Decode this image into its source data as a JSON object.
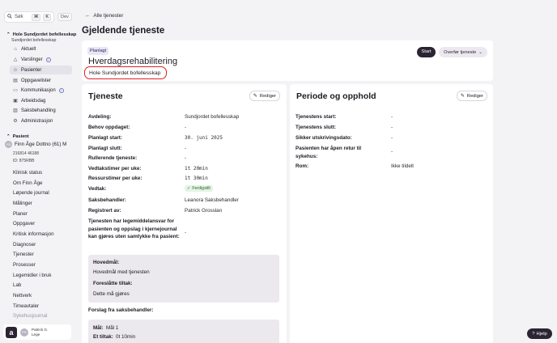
{
  "search": {
    "label": "Søk",
    "shortcut_cmd": "⌘",
    "shortcut_key": "K"
  },
  "dev_label": "Dev",
  "org": {
    "title": "Hole Sundjordet bofellesskap",
    "subtitle": "Sundjordet bofellesskap"
  },
  "nav": [
    {
      "label": "Aktuelt",
      "icon": "home-icon"
    },
    {
      "label": "Varslinger",
      "icon": "bell-icon",
      "badge": "i"
    },
    {
      "label": "Pasienter",
      "icon": "users-icon",
      "active": true
    },
    {
      "label": "Oppgavelister",
      "icon": "calendar-icon"
    },
    {
      "label": "Kommunikasjon",
      "icon": "chat-icon",
      "badge": "i"
    },
    {
      "label": "Arbeidsdag",
      "icon": "briefcase-icon"
    },
    {
      "label": "Saksbehandling",
      "icon": "folder-icon"
    },
    {
      "label": "Administrasjon",
      "icon": "gear-icon"
    }
  ],
  "patient": {
    "header": "Pasient",
    "initials": "FÅ",
    "name": "Finn Åge Dottno (61) M",
    "nr": "216814 46188",
    "id": "ID: 875RBB",
    "links": [
      "Klinisk status",
      "Om Finn Åge",
      "Løpende journal",
      "Målinger",
      "Planer",
      "Oppgaver",
      "Kritisk informasjon",
      "Diagnoser",
      "Tjenester",
      "Prosesser",
      "Legemidler i bruk",
      "Lab",
      "Nettverk",
      "Timeavtaler",
      "Sykehusjournal"
    ]
  },
  "user": {
    "initials": "PG",
    "name": "Patrick G.",
    "role": "Lege"
  },
  "back_label": "Alle tjenester",
  "page_title": "Gjeldende tjeneste",
  "service": {
    "status": "Planlagt",
    "name": "Hverdagsrehabilitering",
    "unit": "Hole Sundjordet bofellesskap",
    "start_label": "Start",
    "transfer_label": "Overfør tjeneste"
  },
  "tjeneste": {
    "title": "Tjeneste",
    "edit_label": "Rediger",
    "fields": [
      {
        "label": "Avdeling:",
        "value": "Sundjordet bofellesskap"
      },
      {
        "label": "Behov oppdaget:",
        "value": "-"
      },
      {
        "label": "Planlagt start:",
        "value": "30. juni 2025"
      },
      {
        "label": "Planlagt slutt:",
        "value": "-"
      },
      {
        "label": "Rullerende tjeneste:",
        "value": "-"
      },
      {
        "label": "Vedtakstimer per uke:",
        "value": "1t 20min"
      },
      {
        "label": "Ressurstimer per uke:",
        "value": "1t 30min"
      },
      {
        "label": "Vedtak:",
        "value": "Ferdigstilt"
      },
      {
        "label": "Saksbehandler:",
        "value": "Leanora Saksbehandler"
      },
      {
        "label": "Registrert av:",
        "value": "Patrick Grosslan"
      },
      {
        "label": "Tjenesten har legemiddelansvar for pasienten og oppslag i kjernejournal kan gjøres uten samtykke fra pasient:",
        "value": "-"
      }
    ],
    "goal_label": "Hovedmål:",
    "goal_value": "Hovedmål med tjenesten",
    "measure_label": "Foreslåtte tiltak:",
    "measure_value": "Dette må gjøres",
    "proposal_title": "Forslag fra saksbehandler:",
    "proposal_goal_label": "Mål:",
    "proposal_goal_value": "Mål 1",
    "proposal_measure_label": "Et tiltak:",
    "proposal_measure_value": "0t 10min"
  },
  "periode": {
    "title": "Periode og opphold",
    "edit_label": "Rediger",
    "fields": [
      {
        "label": "Tjenestens start:",
        "value": "-"
      },
      {
        "label": "Tjenestens slutt:",
        "value": "-"
      },
      {
        "label": "Sikker utskrivingsdato:",
        "value": "-"
      },
      {
        "label": "Pasienten har åpen retur til sykehus:",
        "value": "-"
      },
      {
        "label": "Rom:",
        "value": "Ikke tildelt"
      }
    ]
  },
  "help_label": "Hjelp"
}
